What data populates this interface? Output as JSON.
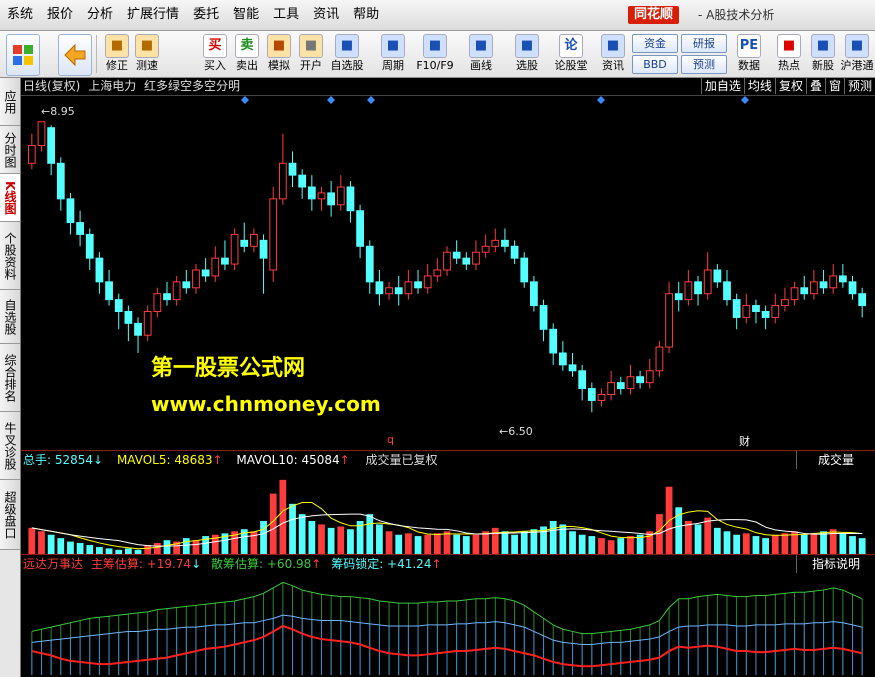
{
  "menubar": {
    "items": [
      "系统",
      "报价",
      "分析",
      "扩展行情",
      "委托",
      "智能",
      "工具",
      "资讯",
      "帮助"
    ],
    "brand": "同花顺",
    "app_title": "- A股技术分析"
  },
  "toolbar": {
    "buttons": [
      {
        "label": "修正",
        "icon": "up-down-arrows-icon"
      },
      {
        "label": "测速",
        "icon": "speedometer-icon"
      },
      {
        "label": "买入",
        "icon": "buy-icon",
        "glyph": "买"
      },
      {
        "label": "卖出",
        "icon": "sell-icon",
        "glyph": "卖"
      },
      {
        "label": "模拟",
        "icon": "hammer-icon"
      },
      {
        "label": "开户",
        "icon": "lock-icon"
      },
      {
        "label": "自选股",
        "icon": "star-folder-icon"
      },
      {
        "label": "周期",
        "icon": "clock-icon"
      },
      {
        "label": "F10/F9",
        "icon": "f10-icon"
      },
      {
        "label": "画线",
        "icon": "pen-icon"
      },
      {
        "label": "选股",
        "icon": "screen-icon"
      },
      {
        "label": "论股堂",
        "icon": "forum-icon",
        "glyph": "论"
      },
      {
        "label": "资讯",
        "icon": "news-icon"
      },
      {
        "label": "数据",
        "icon": "pe-icon",
        "glyph": "PE"
      },
      {
        "label": "热点",
        "icon": "hot-icon"
      },
      {
        "label": "新股",
        "icon": "ipo-icon"
      },
      {
        "label": "沪港通",
        "icon": "shhk-icon"
      }
    ],
    "mini_buttons": [
      "资金",
      "BBD",
      "研报",
      "预测"
    ]
  },
  "sidebar": {
    "tabs": [
      "应用",
      "分时图",
      "K线图",
      "个股资料",
      "自选股",
      "综合排名",
      "牛叉诊股",
      "超级盘口"
    ],
    "active_index": 2
  },
  "chart_header": {
    "period": "日线(复权)",
    "stock": "上海电力",
    "formula": "红多绿空多空分明",
    "buttons": [
      "加自选",
      "均线",
      "复权",
      "叠",
      "窗",
      "预测"
    ]
  },
  "price_panel": {
    "high_label": "8.95",
    "low_label": "6.50",
    "marker_q": "q",
    "marker_cai": "财",
    "watermark_line1": "第一股票公式网",
    "watermark_line2": "www.chnmoney.com"
  },
  "volume_panel": {
    "total_label": "总手: 52854",
    "mavol5_label": "MAVOL5: 48683",
    "mavol10_label": "MAVOL10: 45084",
    "note": "成交量已复权",
    "tab": "成交量"
  },
  "indicator_panel": {
    "name": "远达万事达",
    "main_label": "主筹估算: +19.74",
    "retail_label": "散筹估算: +60.98",
    "lock_label": "筹码锁定: +41.24",
    "tab": "指标说明"
  },
  "colors": {
    "up": "#ff3c3c",
    "down": "#54ffff",
    "mavol5": "#ffff00",
    "mavol10": "#ffffff",
    "indicator_green": "#3cc83c",
    "indicator_red": "#ff2020",
    "indicator_blue": "#3c8cff"
  },
  "chart_data": {
    "type": "candlestick",
    "ylim": [
      6.3,
      9.1
    ],
    "candles": [
      [
        8.6,
        8.75,
        8.85,
        8.55
      ],
      [
        8.75,
        8.95,
        8.95,
        8.7
      ],
      [
        8.9,
        8.6,
        8.92,
        8.5
      ],
      [
        8.6,
        8.3,
        8.65,
        8.2
      ],
      [
        8.3,
        8.1,
        8.35,
        8.0
      ],
      [
        8.1,
        8.0,
        8.2,
        7.9
      ],
      [
        8.0,
        7.8,
        8.05,
        7.7
      ],
      [
        7.8,
        7.6,
        7.85,
        7.5
      ],
      [
        7.6,
        7.45,
        7.7,
        7.4
      ],
      [
        7.45,
        7.35,
        7.5,
        7.2
      ],
      [
        7.35,
        7.25,
        7.4,
        7.1
      ],
      [
        7.25,
        7.15,
        7.3,
        7.0
      ],
      [
        7.15,
        7.35,
        7.4,
        7.1
      ],
      [
        7.35,
        7.5,
        7.55,
        7.3
      ],
      [
        7.5,
        7.45,
        7.6,
        7.4
      ],
      [
        7.45,
        7.6,
        7.65,
        7.4
      ],
      [
        7.6,
        7.55,
        7.7,
        7.5
      ],
      [
        7.55,
        7.7,
        7.75,
        7.5
      ],
      [
        7.7,
        7.65,
        7.8,
        7.6
      ],
      [
        7.65,
        7.8,
        7.9,
        7.6
      ],
      [
        7.8,
        7.75,
        7.95,
        7.7
      ],
      [
        7.75,
        8.0,
        8.05,
        7.7
      ],
      [
        7.95,
        7.9,
        8.1,
        7.85
      ],
      [
        7.9,
        8.0,
        8.05,
        7.85
      ],
      [
        7.95,
        7.8,
        8.0,
        7.5
      ],
      [
        7.7,
        8.3,
        8.4,
        7.6
      ],
      [
        8.3,
        8.6,
        8.85,
        8.25
      ],
      [
        8.6,
        8.5,
        8.7,
        8.4
      ],
      [
        8.5,
        8.4,
        8.55,
        8.3
      ],
      [
        8.4,
        8.3,
        8.5,
        8.2
      ],
      [
        8.3,
        8.35,
        8.4,
        8.2
      ],
      [
        8.35,
        8.25,
        8.45,
        8.15
      ],
      [
        8.25,
        8.4,
        8.5,
        8.2
      ],
      [
        8.4,
        8.2,
        8.45,
        8.1
      ],
      [
        8.2,
        7.9,
        8.25,
        7.8
      ],
      [
        7.9,
        7.6,
        7.95,
        7.5
      ],
      [
        7.6,
        7.5,
        7.7,
        7.4
      ],
      [
        7.5,
        7.55,
        7.6,
        7.45
      ],
      [
        7.55,
        7.5,
        7.65,
        7.4
      ],
      [
        7.5,
        7.6,
        7.7,
        7.45
      ],
      [
        7.6,
        7.55,
        7.7,
        7.5
      ],
      [
        7.55,
        7.65,
        7.75,
        7.5
      ],
      [
        7.65,
        7.7,
        7.8,
        7.6
      ],
      [
        7.7,
        7.85,
        7.9,
        7.65
      ],
      [
        7.85,
        7.8,
        7.95,
        7.75
      ],
      [
        7.8,
        7.75,
        7.85,
        7.7
      ],
      [
        7.75,
        7.85,
        7.95,
        7.7
      ],
      [
        7.85,
        7.9,
        8.0,
        7.8
      ],
      [
        7.9,
        7.95,
        8.05,
        7.85
      ],
      [
        7.95,
        7.9,
        8.05,
        7.85
      ],
      [
        7.9,
        7.8,
        7.95,
        7.75
      ],
      [
        7.8,
        7.6,
        7.85,
        7.55
      ],
      [
        7.6,
        7.4,
        7.65,
        7.35
      ],
      [
        7.4,
        7.2,
        7.45,
        7.1
      ],
      [
        7.2,
        7.0,
        7.25,
        6.9
      ],
      [
        7.0,
        6.9,
        7.1,
        6.85
      ],
      [
        6.9,
        6.85,
        7.0,
        6.8
      ],
      [
        6.85,
        6.7,
        6.9,
        6.6
      ],
      [
        6.7,
        6.6,
        6.75,
        6.5
      ],
      [
        6.6,
        6.65,
        6.7,
        6.55
      ],
      [
        6.65,
        6.75,
        6.85,
        6.6
      ],
      [
        6.75,
        6.7,
        6.8,
        6.65
      ],
      [
        6.7,
        6.8,
        6.9,
        6.65
      ],
      [
        6.8,
        6.75,
        6.85,
        6.7
      ],
      [
        6.75,
        6.85,
        6.95,
        6.7
      ],
      [
        6.85,
        7.05,
        7.1,
        6.8
      ],
      [
        7.05,
        7.5,
        7.6,
        7.0
      ],
      [
        7.5,
        7.45,
        7.6,
        7.35
      ],
      [
        7.45,
        7.6,
        7.7,
        7.4
      ],
      [
        7.6,
        7.5,
        7.65,
        7.4
      ],
      [
        7.5,
        7.7,
        7.85,
        7.45
      ],
      [
        7.7,
        7.6,
        7.75,
        7.55
      ],
      [
        7.6,
        7.45,
        7.7,
        7.4
      ],
      [
        7.45,
        7.3,
        7.5,
        7.2
      ],
      [
        7.3,
        7.4,
        7.5,
        7.25
      ],
      [
        7.4,
        7.35,
        7.45,
        7.25
      ],
      [
        7.35,
        7.3,
        7.4,
        7.2
      ],
      [
        7.3,
        7.4,
        7.5,
        7.25
      ],
      [
        7.4,
        7.45,
        7.55,
        7.35
      ],
      [
        7.45,
        7.55,
        7.6,
        7.4
      ],
      [
        7.55,
        7.5,
        7.65,
        7.45
      ],
      [
        7.5,
        7.6,
        7.7,
        7.45
      ],
      [
        7.6,
        7.55,
        7.7,
        7.5
      ],
      [
        7.55,
        7.65,
        7.75,
        7.5
      ],
      [
        7.65,
        7.6,
        7.75,
        7.55
      ],
      [
        7.6,
        7.5,
        7.65,
        7.45
      ],
      [
        7.5,
        7.4,
        7.55,
        7.3
      ]
    ],
    "volumes": [
      60,
      55,
      50,
      45,
      40,
      38,
      35,
      32,
      30,
      28,
      30,
      28,
      35,
      38,
      42,
      40,
      45,
      42,
      48,
      50,
      52,
      55,
      58,
      55,
      70,
      110,
      130,
      95,
      80,
      70,
      65,
      60,
      62,
      58,
      70,
      80,
      65,
      55,
      50,
      52,
      48,
      50,
      52,
      55,
      50,
      48,
      50,
      55,
      60,
      55,
      50,
      55,
      58,
      62,
      70,
      65,
      55,
      50,
      48,
      45,
      42,
      45,
      48,
      50,
      55,
      80,
      120,
      90,
      70,
      65,
      75,
      60,
      55,
      50,
      52,
      48,
      45,
      50,
      52,
      55,
      50,
      52,
      55,
      58,
      52,
      48,
      45
    ],
    "indicator": {
      "main": [
        22,
        20,
        18,
        15,
        13,
        12,
        11,
        10,
        10,
        11,
        12,
        13,
        14,
        15,
        16,
        18,
        20,
        22,
        24,
        25,
        26,
        28,
        30,
        32,
        35,
        40,
        45,
        42,
        38,
        35,
        33,
        32,
        31,
        30,
        28,
        25,
        22,
        20,
        19,
        18,
        18,
        19,
        20,
        21,
        22,
        22,
        23,
        24,
        25,
        24,
        22,
        20,
        18,
        15,
        12,
        10,
        9,
        8,
        8,
        9,
        10,
        11,
        12,
        13,
        14,
        16,
        22,
        26,
        25,
        26,
        27,
        26,
        24,
        22,
        22,
        21,
        21,
        22,
        23,
        24,
        23,
        23,
        24,
        25,
        24,
        22,
        20
      ],
      "retail": [
        40,
        42,
        44,
        46,
        48,
        50,
        52,
        53,
        54,
        55,
        56,
        57,
        58,
        60,
        61,
        62,
        63,
        64,
        65,
        66,
        67,
        68,
        70,
        72,
        75,
        80,
        85,
        82,
        78,
        76,
        74,
        73,
        72,
        72,
        71,
        70,
        68,
        67,
        66,
        66,
        66,
        67,
        67,
        68,
        68,
        69,
        70,
        70,
        71,
        70,
        68,
        64,
        58,
        52,
        46,
        42,
        40,
        38,
        38,
        39,
        40,
        41,
        42,
        44,
        46,
        50,
        62,
        70,
        70,
        72,
        73,
        74,
        73,
        72,
        72,
        73,
        73,
        74,
        75,
        76,
        76,
        77,
        78,
        80,
        78,
        74,
        70
      ],
      "lock": [
        30,
        31,
        32,
        33,
        34,
        35,
        36,
        37,
        38,
        39,
        40,
        40,
        41,
        42,
        42,
        43,
        44,
        44,
        45,
        46,
        46,
        47,
        48,
        48,
        50,
        52,
        55,
        54,
        52,
        51,
        50,
        50,
        50,
        49,
        48,
        47,
        46,
        45,
        45,
        45,
        45,
        46,
        46,
        46,
        47,
        47,
        48,
        48,
        49,
        48,
        46,
        44,
        40,
        36,
        32,
        30,
        29,
        28,
        28,
        29,
        30,
        30,
        31,
        32,
        33,
        35,
        40,
        44,
        45,
        45,
        46,
        46,
        46,
        45,
        45,
        46,
        46,
        46,
        47,
        47,
        47,
        48,
        48,
        49,
        48,
        46,
        44
      ]
    }
  }
}
